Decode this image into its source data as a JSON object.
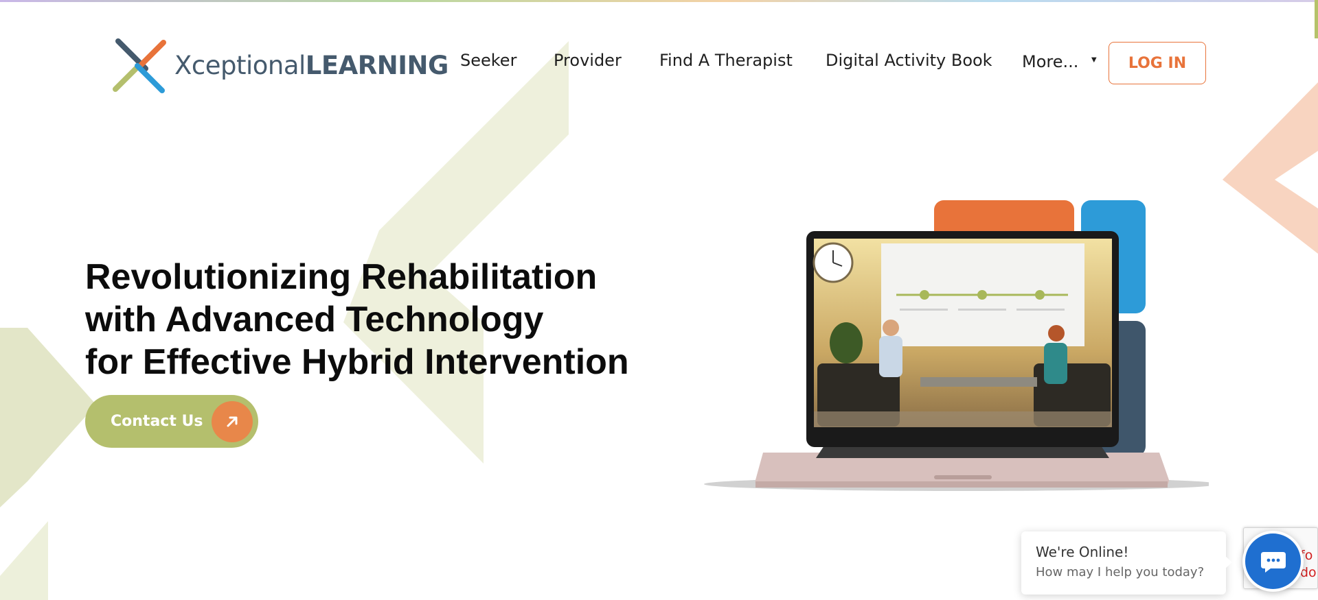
{
  "header": {
    "logo": {
      "text_light": "Xceptional",
      "text_bold": "LEARNING"
    },
    "nav": [
      {
        "label": "Seeker"
      },
      {
        "label": "Provider"
      },
      {
        "label": "Find A Therapist"
      },
      {
        "label": "Digital Activity Book"
      }
    ],
    "more": {
      "label": "More...",
      "caret": "▼"
    },
    "login_label": "LOG IN"
  },
  "hero": {
    "title_lines": [
      "Revolutionizing Rehabilitation",
      "with Advanced Technology",
      "for Effective Hybrid Intervention"
    ],
    "cta_label": "Contact Us",
    "cta_icon": "arrow-up-right-icon"
  },
  "chat": {
    "title": "We're Online!",
    "subtitle": "How may I help you today?",
    "launcher_icon": "chat-bubble-icon"
  },
  "recaptcha": {
    "line1": "fo",
    "line2": "do"
  },
  "colors": {
    "brand_orange": "#e8733a",
    "brand_green": "#b4bf6d",
    "brand_blue": "#2d9bd8",
    "brand_slate": "#455a6d",
    "chat_blue": "#1f6fd0"
  }
}
